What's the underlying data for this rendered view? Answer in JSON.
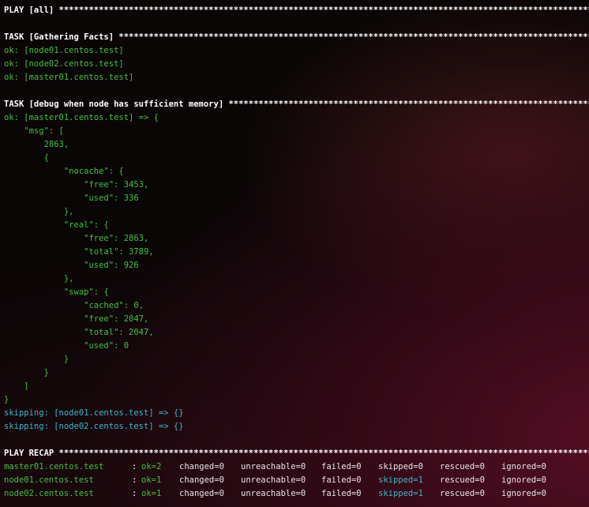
{
  "lines": [
    {
      "text": "PLAY [all] ****************************************************************************************************************",
      "cls": "hdr"
    },
    {
      "text": "",
      "cls": "w"
    },
    {
      "text": "TASK [Gathering Facts] ****************************************************************************************************",
      "cls": "hdr"
    },
    {
      "text": "ok: [node01.centos.test]",
      "cls": "g"
    },
    {
      "text": "ok: [node02.centos.test]",
      "cls": "g"
    },
    {
      "text": "ok: [master01.centos.test]",
      "cls": "g"
    },
    {
      "text": "",
      "cls": "w"
    },
    {
      "text": "TASK [debug when node has sufficient memory] **********************************************************************************",
      "cls": "hdr"
    },
    {
      "text": "ok: [master01.centos.test] => {",
      "cls": "g"
    },
    {
      "text": "    \"msg\": [",
      "cls": "g"
    },
    {
      "text": "        2863,",
      "cls": "g"
    },
    {
      "text": "        {",
      "cls": "g"
    },
    {
      "text": "            \"nocache\": {",
      "cls": "g"
    },
    {
      "text": "                \"free\": 3453,",
      "cls": "g"
    },
    {
      "text": "                \"used\": 336",
      "cls": "g"
    },
    {
      "text": "            },",
      "cls": "g"
    },
    {
      "text": "            \"real\": {",
      "cls": "g"
    },
    {
      "text": "                \"free\": 2863,",
      "cls": "g"
    },
    {
      "text": "                \"total\": 3789,",
      "cls": "g"
    },
    {
      "text": "                \"used\": 926",
      "cls": "g"
    },
    {
      "text": "            },",
      "cls": "g"
    },
    {
      "text": "            \"swap\": {",
      "cls": "g"
    },
    {
      "text": "                \"cached\": 0,",
      "cls": "g"
    },
    {
      "text": "                \"free\": 2047,",
      "cls": "g"
    },
    {
      "text": "                \"total\": 2047,",
      "cls": "g"
    },
    {
      "text": "                \"used\": 0",
      "cls": "g"
    },
    {
      "text": "            }",
      "cls": "g"
    },
    {
      "text": "        }",
      "cls": "g"
    },
    {
      "text": "    ]",
      "cls": "g"
    },
    {
      "text": "}",
      "cls": "g"
    },
    {
      "text": "skipping: [node01.centos.test] => {}",
      "cls": "c"
    },
    {
      "text": "skipping: [node02.centos.test] => {}",
      "cls": "c"
    },
    {
      "text": "",
      "cls": "w"
    },
    {
      "text": "PLAY RECAP ****************************************************************************************************************",
      "cls": "hdr"
    }
  ],
  "recap": [
    {
      "host": "master01.centos.test",
      "colon": ":",
      "ok": "ok=2",
      "changed": "changed=0",
      "unreachable": "unreachable=0",
      "failed": "failed=0",
      "skipped": "skipped=0",
      "skipped_cls": "w",
      "rescued": "rescued=0",
      "ignored": "ignored=0"
    },
    {
      "host": "node01.centos.test",
      "colon": ":",
      "ok": "ok=1",
      "changed": "changed=0",
      "unreachable": "unreachable=0",
      "failed": "failed=0",
      "skipped": "skipped=1",
      "skipped_cls": "c",
      "rescued": "rescued=0",
      "ignored": "ignored=0"
    },
    {
      "host": "node02.centos.test",
      "colon": ":",
      "ok": "ok=1",
      "changed": "changed=0",
      "unreachable": "unreachable=0",
      "failed": "failed=0",
      "skipped": "skipped=1",
      "skipped_cls": "c",
      "rescued": "rescued=0",
      "ignored": "ignored=0"
    }
  ]
}
